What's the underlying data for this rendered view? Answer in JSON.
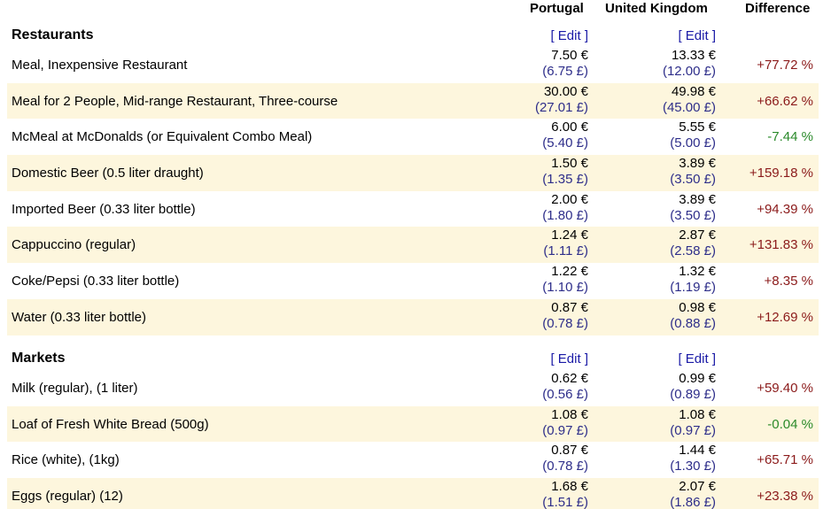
{
  "header": {
    "col1": "Portugal",
    "col2": "United Kingdom",
    "col3": "Difference"
  },
  "sections": [
    {
      "title": "Restaurants",
      "edit_label": "[ Edit ]",
      "rows": [
        {
          "name": "Meal, Inexpensive Restaurant",
          "p1_eur": "7.50 €",
          "p1_gbp": "(6.75 £)",
          "p2_eur": "13.33 €",
          "p2_gbp": "(12.00 £)",
          "diff": "+77.72 %"
        },
        {
          "name": "Meal for 2 People, Mid-range Restaurant, Three-course",
          "p1_eur": "30.00 €",
          "p1_gbp": "(27.01 £)",
          "p2_eur": "49.98 €",
          "p2_gbp": "(45.00 £)",
          "diff": "+66.62 %"
        },
        {
          "name": "McMeal at McDonalds (or Equivalent Combo Meal)",
          "p1_eur": "6.00 €",
          "p1_gbp": "(5.40 £)",
          "p2_eur": "5.55 €",
          "p2_gbp": "(5.00 £)",
          "diff": "-7.44 %"
        },
        {
          "name": "Domestic Beer (0.5 liter draught)",
          "p1_eur": "1.50 €",
          "p1_gbp": "(1.35 £)",
          "p2_eur": "3.89 €",
          "p2_gbp": "(3.50 £)",
          "diff": "+159.18 %"
        },
        {
          "name": "Imported Beer (0.33 liter bottle)",
          "p1_eur": "2.00 €",
          "p1_gbp": "(1.80 £)",
          "p2_eur": "3.89 €",
          "p2_gbp": "(3.50 £)",
          "diff": "+94.39 %"
        },
        {
          "name": "Cappuccino (regular)",
          "p1_eur": "1.24 €",
          "p1_gbp": "(1.11 £)",
          "p2_eur": "2.87 €",
          "p2_gbp": "(2.58 £)",
          "diff": "+131.83 %"
        },
        {
          "name": "Coke/Pepsi (0.33 liter bottle)",
          "p1_eur": "1.22 €",
          "p1_gbp": "(1.10 £)",
          "p2_eur": "1.32 €",
          "p2_gbp": "(1.19 £)",
          "diff": "+8.35 %"
        },
        {
          "name": "Water (0.33 liter bottle)",
          "p1_eur": "0.87 €",
          "p1_gbp": "(0.78 £)",
          "p2_eur": "0.98 €",
          "p2_gbp": "(0.88 £)",
          "diff": "+12.69 %"
        }
      ]
    },
    {
      "title": "Markets",
      "edit_label": "[ Edit ]",
      "rows": [
        {
          "name": "Milk (regular), (1 liter)",
          "p1_eur": "0.62 €",
          "p1_gbp": "(0.56 £)",
          "p2_eur": "0.99 €",
          "p2_gbp": "(0.89 £)",
          "diff": "+59.40 %"
        },
        {
          "name": "Loaf of Fresh White Bread (500g)",
          "p1_eur": "1.08 €",
          "p1_gbp": "(0.97 £)",
          "p2_eur": "1.08 €",
          "p2_gbp": "(0.97 £)",
          "diff": "-0.04 %"
        },
        {
          "name": "Rice (white), (1kg)",
          "p1_eur": "0.87 €",
          "p1_gbp": "(0.78 £)",
          "p2_eur": "1.44 €",
          "p2_gbp": "(1.30 £)",
          "diff": "+65.71 %"
        },
        {
          "name": "Eggs (regular) (12)",
          "p1_eur": "1.68 €",
          "p1_gbp": "(1.51 £)",
          "p2_eur": "2.07 €",
          "p2_gbp": "(1.86 £)",
          "diff": "+23.38 %"
        }
      ]
    }
  ],
  "colors": {
    "row_alt_bg": "#fdf6dd",
    "positive_diff": "#8b1a1a",
    "negative_diff": "#2a8a2a",
    "edit_link": "#1a1aa6",
    "gbp_text": "#2e2e8a"
  }
}
